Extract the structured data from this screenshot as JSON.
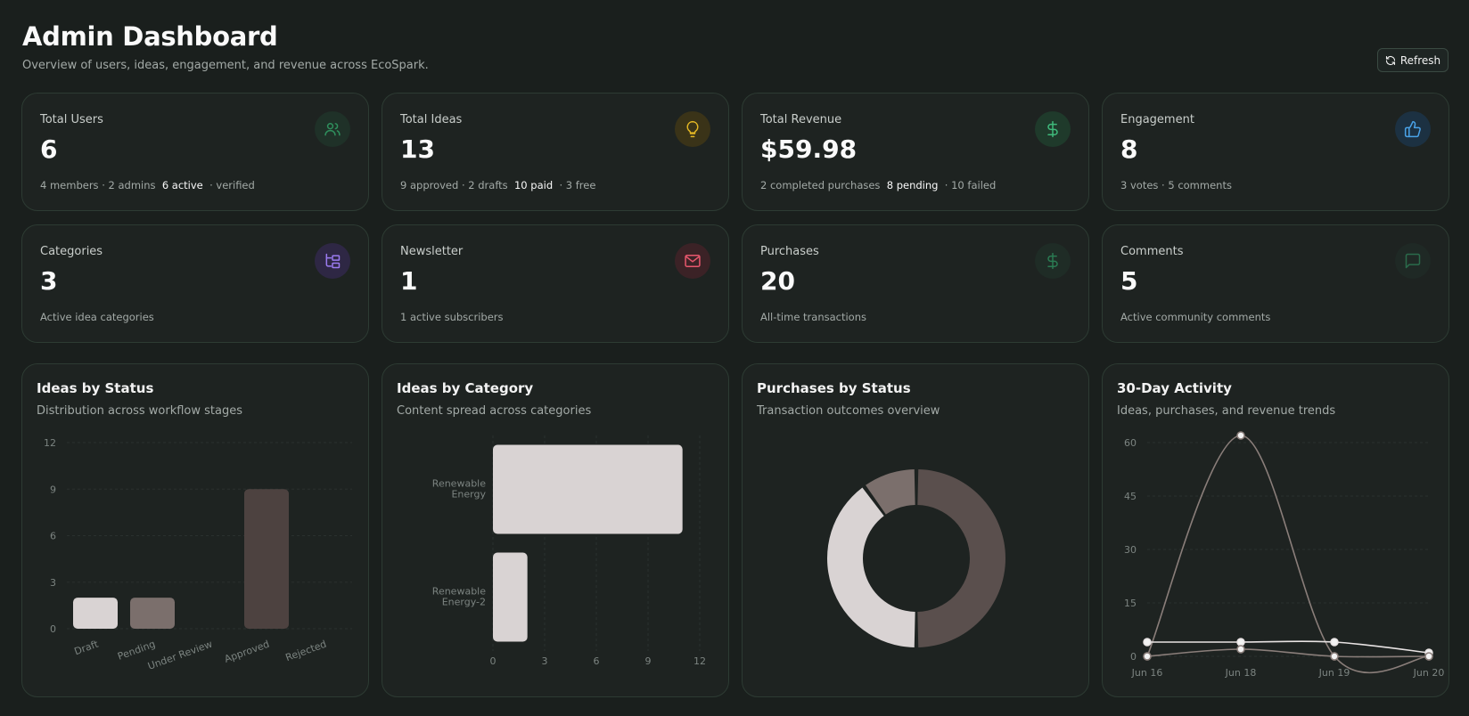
{
  "header": {
    "title": "Admin Dashboard",
    "subtitle": "Overview of users, ideas, engagement, and revenue across EcoSpark.",
    "refresh_label": "Refresh"
  },
  "colors": {
    "background": "#1a1f1d",
    "card": "#1e2321",
    "card_border": "#2d3b33",
    "green_accent": "#3fb97b",
    "yellow_accent": "#e5b824",
    "blue_accent": "#4aa3e8",
    "purple_accent": "#9b7cf0",
    "pink_accent": "#e8576d",
    "bar_light": "#d9d3d3",
    "bar_mid": "#7b6f6c",
    "bar_dark": "#4d4240"
  },
  "stats": [
    {
      "label": "Total Users",
      "value": "6",
      "note_pre": "4 members · 2 admins",
      "note_hl": "6 active",
      "note_post": "· verified",
      "icon": "users-icon"
    },
    {
      "label": "Total Ideas",
      "value": "13",
      "note_pre": "9 approved · 2 drafts",
      "note_hl": "10 paid",
      "note_post": "· 3 free",
      "icon": "lightbulb-icon"
    },
    {
      "label": "Total Revenue",
      "value": "$59.98",
      "note_pre": "2 completed purchases",
      "note_hl": "8 pending",
      "note_post": "· 10 failed",
      "icon": "dollar-icon"
    },
    {
      "label": "Engagement",
      "value": "8",
      "note_pre": "3 votes · 5 comments",
      "note_hl": "",
      "note_post": "",
      "icon": "thumbs-up-icon"
    },
    {
      "label": "Categories",
      "value": "3",
      "note_pre": "Active idea categories",
      "note_hl": "",
      "note_post": "",
      "icon": "folder-tree-icon"
    },
    {
      "label": "Newsletter",
      "value": "1",
      "note_pre": "1 active subscribers",
      "note_hl": "",
      "note_post": "",
      "icon": "mail-icon"
    },
    {
      "label": "Purchases",
      "value": "20",
      "note_pre": "All-time transactions",
      "note_hl": "",
      "note_post": "",
      "icon": "dollar-icon"
    },
    {
      "label": "Comments",
      "value": "5",
      "note_pre": "Active community comments",
      "note_hl": "",
      "note_post": "",
      "icon": "message-square-icon"
    }
  ],
  "charts": [
    {
      "title": "Ideas by Status",
      "subtitle": "Distribution across workflow stages"
    },
    {
      "title": "Ideas by Category",
      "subtitle": "Content spread across categories"
    },
    {
      "title": "Purchases by Status",
      "subtitle": "Transaction outcomes overview"
    },
    {
      "title": "30-Day Activity",
      "subtitle": "Ideas, purchases, and revenue trends"
    }
  ],
  "chart_data": [
    {
      "type": "bar",
      "title": "Ideas by Status",
      "categories": [
        "Draft",
        "Pending",
        "Under Review",
        "Approved",
        "Rejected"
      ],
      "values": [
        2,
        2,
        0,
        9,
        0
      ],
      "colors": [
        "#d9d3d3",
        "#7b6f6c",
        "#5c5250",
        "#4d4240",
        "#3d3534"
      ],
      "ylim": [
        0,
        12
      ],
      "yticks": [
        0,
        3,
        6,
        9,
        12
      ],
      "grid": true
    },
    {
      "type": "bar",
      "orientation": "horizontal",
      "title": "Ideas by Category",
      "categories": [
        "Renewable Energy",
        "Renewable Energy-2"
      ],
      "values": [
        11,
        2
      ],
      "xlim": [
        0,
        12
      ],
      "xticks": [
        0,
        3,
        6,
        9,
        12
      ],
      "grid": true
    },
    {
      "type": "pie",
      "donut": true,
      "title": "Purchases by Status",
      "values": [
        8,
        2,
        10
      ],
      "colors": [
        "#d9d3d3",
        "#7b6f6c",
        "#5a4f4d"
      ]
    },
    {
      "type": "line",
      "title": "30-Day Activity",
      "x": [
        "Jun 16",
        "Jun 18",
        "Jun 19",
        "Jun 20"
      ],
      "ylim": [
        0,
        60
      ],
      "yticks": [
        0,
        15,
        30,
        45,
        60
      ],
      "grid": true,
      "series": [
        {
          "values": [
            0,
            62,
            0,
            0
          ],
          "color": "#8a7e7a"
        },
        {
          "values": [
            4,
            4,
            4,
            1
          ],
          "color": "#e8e3e3"
        },
        {
          "values": [
            0,
            2,
            0,
            0
          ],
          "color": "#8a7e7a"
        }
      ]
    }
  ]
}
